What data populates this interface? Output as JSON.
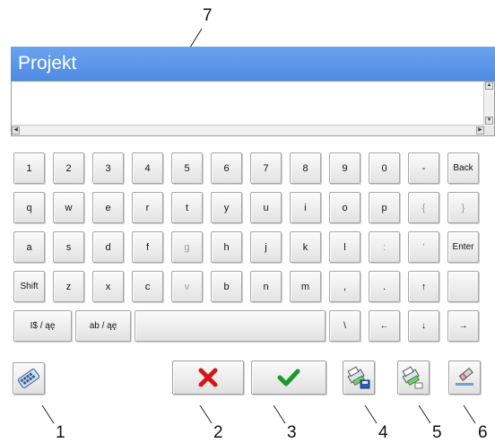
{
  "dialog": {
    "title": "Projekt",
    "text_value": ""
  },
  "keyboard": {
    "rows": [
      [
        "1",
        "2",
        "3",
        "4",
        "5",
        "6",
        "7",
        "8",
        "9",
        "0",
        "-",
        "Back"
      ],
      [
        "q",
        "w",
        "e",
        "r",
        "t",
        "y",
        "u",
        "i",
        "o",
        "p",
        "{",
        "}"
      ],
      [
        "a",
        "s",
        "d",
        "f",
        "g",
        "h",
        "j",
        "k",
        "l",
        ":",
        "'",
        "Enter"
      ],
      [
        "Shift",
        "z",
        "x",
        "c",
        "v",
        "b",
        "n",
        "m",
        ",",
        ".",
        "↑",
        ""
      ],
      [
        "I$ / ąę",
        "ab / ąę",
        "",
        "\\",
        "←",
        "↓",
        "→"
      ]
    ]
  },
  "actions": {
    "layout_icon": "keyboard-layout-icon",
    "cancel_icon": "red-x-icon",
    "confirm_icon": "green-check-icon",
    "save_icon": "printer-disk-icon",
    "print_icon": "printer-icon",
    "clear_icon": "eraser-icon"
  },
  "callouts": [
    "1",
    "2",
    "3",
    "4",
    "5",
    "6",
    "7"
  ],
  "colors": {
    "title_bar": "#5b95e8",
    "cancel": "#d01818",
    "confirm": "#1a9a2a"
  }
}
